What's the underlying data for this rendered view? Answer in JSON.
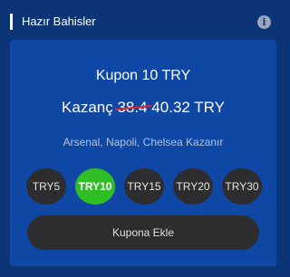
{
  "header": {
    "title": "Hazır Bahisler",
    "info_icon_glyph": "i"
  },
  "coupon": {
    "title": "Kupon 10 TRY",
    "win_label": "Kazanç",
    "old_value": "38.4",
    "new_value": "40.32 TRY",
    "teams": "Arsenal, Napoli, Chelsea Kazanır",
    "amounts": [
      "TRY5",
      "TRY10",
      "TRY15",
      "TRY20",
      "TRY30"
    ],
    "selected_amount": "TRY10",
    "add_button": "Kupona Ekle"
  },
  "colors": {
    "background": "#0b3577",
    "card": "#0f47a5",
    "selected": "#2fbf25",
    "button": "#2d2d2f",
    "strike": "#e0242a"
  }
}
